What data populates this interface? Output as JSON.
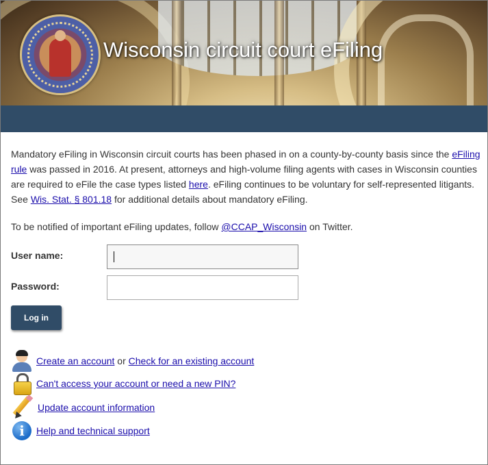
{
  "banner": {
    "title": "Wisconsin circuit court eFiling"
  },
  "intro": {
    "p1_a": "Mandatory eFiling in Wisconsin circuit courts has been phased in on a county-by-county basis since the ",
    "p1_link1": "eFiling rule",
    "p1_b": " was passed in 2016. At present, attorneys and high-volume filing agents with cases in Wisconsin counties are required to eFile the case types listed ",
    "p1_link2": "here",
    "p1_c": ". eFiling continues to be voluntary for self-represented litigants. See ",
    "p1_link3": "Wis. Stat. § 801.18",
    "p1_d": " for additional details about mandatory eFiling.",
    "p2_a": "To be notified of important eFiling updates, follow ",
    "p2_link": "@CCAP_Wisconsin",
    "p2_b": " on Twitter."
  },
  "login": {
    "username_label": "User name:",
    "username_value": "",
    "password_label": "Password:",
    "password_value": "",
    "button_label": "Log in"
  },
  "links": {
    "create_account": "Create an account",
    "or": " or ",
    "check_account": "Check for an existing account",
    "cant_access": "Can't access your account or need a new PIN?",
    "update_account": "Update account information",
    "help": "Help and technical support"
  },
  "icons": {
    "user": "user-icon",
    "lock": "lock-icon",
    "pencil": "pencil-icon",
    "info": "info-icon"
  },
  "colors": {
    "header_bar": "#304c67",
    "link": "#1a0dab",
    "button": "#304c67"
  }
}
